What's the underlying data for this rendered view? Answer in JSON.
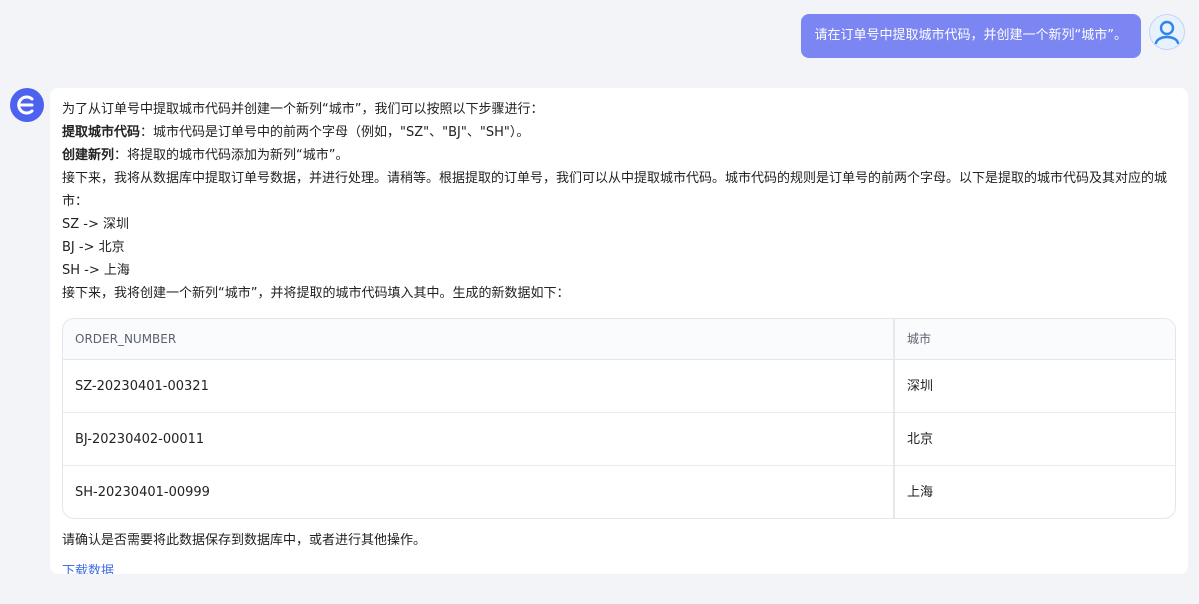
{
  "user": {
    "message": "请在订单号中提取城市代码，并创建一个新列“城市”。"
  },
  "assistant": {
    "intro": "为了从订单号中提取城市代码并创建一个新列“城市”，我们可以按照以下步骤进行：",
    "step1_label": "提取城市代码",
    "step1_text": "：城市代码是订单号中的前两个字母（例如，\"SZ\"、\"BJ\"、\"SH\"）。",
    "step2_label": "创建新列",
    "step2_text": "：将提取的城市代码添加为新列“城市”。",
    "processing": "接下来，我将从数据库中提取订单号数据，并进行处理。请稍等。根据提取的订单号，我们可以从中提取城市代码。城市代码的规则是订单号的前两个字母。以下是提取的城市代码及其对应的城市：",
    "mappings": [
      "SZ -> 深圳",
      "BJ -> 北京",
      "SH -> 上海"
    ],
    "next_step": "接下来，我将创建一个新列“城市”，并将提取的城市代码填入其中。生成的新数据如下：",
    "table": {
      "headers": [
        "ORDER_NUMBER",
        "城市"
      ],
      "rows": [
        [
          "SZ-20230401-00321",
          "深圳"
        ],
        [
          "BJ-20230402-00011",
          "北京"
        ],
        [
          "SH-20230401-00999",
          "上海"
        ]
      ]
    },
    "confirm": "请确认是否需要将此数据保存到数据库中，或者进行其他操作。",
    "download_link": "下载数据"
  },
  "colors": {
    "user_bubble": "#7b86f2",
    "bot_avatar": "#4d63f0",
    "link": "#3f6ee8",
    "background": "#f3f4f7"
  },
  "icons": {
    "bot_avatar": "bot-logo-icon",
    "user_avatar": "user-avatar-icon"
  }
}
